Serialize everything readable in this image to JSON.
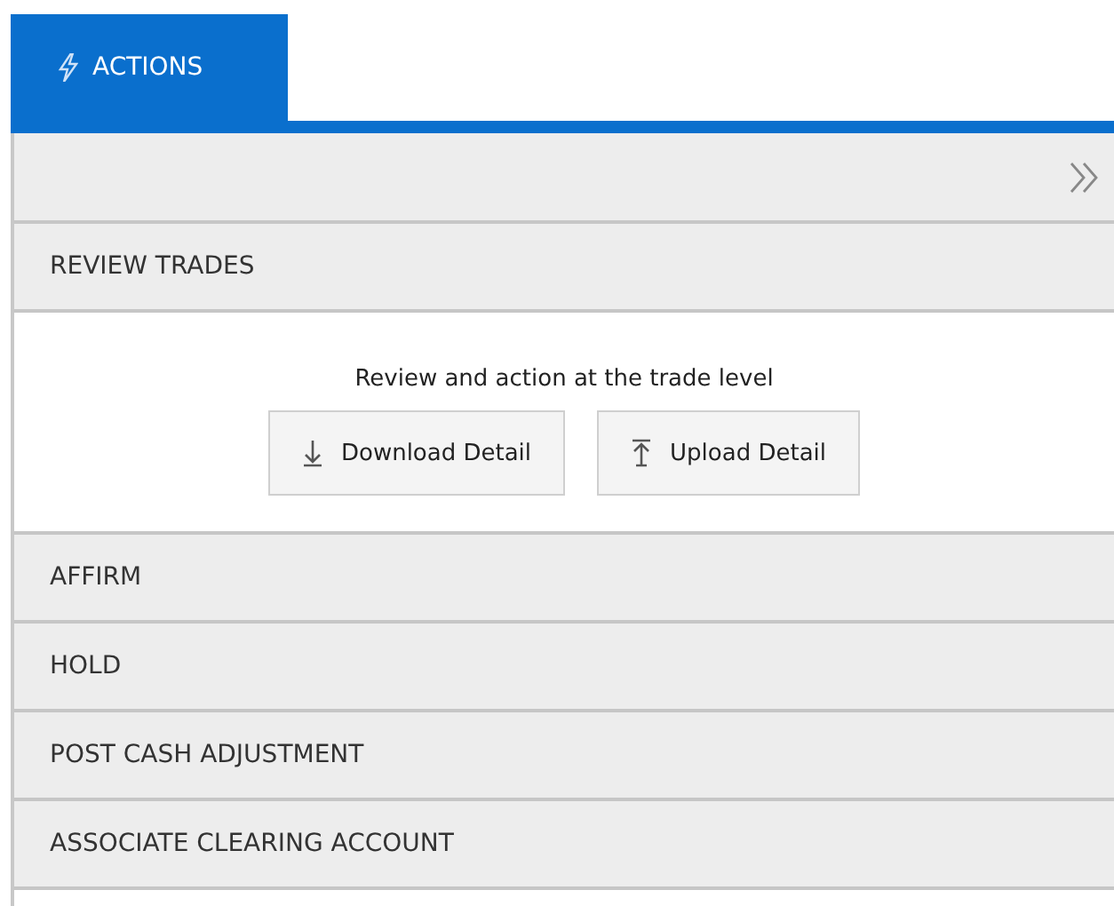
{
  "tabs": [
    {
      "label": "ACTIONS",
      "selected": true
    }
  ],
  "sections": [
    {
      "title": "REVIEW TRADES",
      "description": "Review and action at the trade level",
      "buttons": [
        {
          "label": "Download Detail",
          "kind": "download"
        },
        {
          "label": "Upload Detail",
          "kind": "upload"
        }
      ]
    },
    {
      "title": "AFFIRM"
    },
    {
      "title": "HOLD"
    },
    {
      "title": "POST CASH ADJUSTMENT"
    },
    {
      "title": "ASSOCIATE CLEARING ACCOUNT"
    }
  ]
}
